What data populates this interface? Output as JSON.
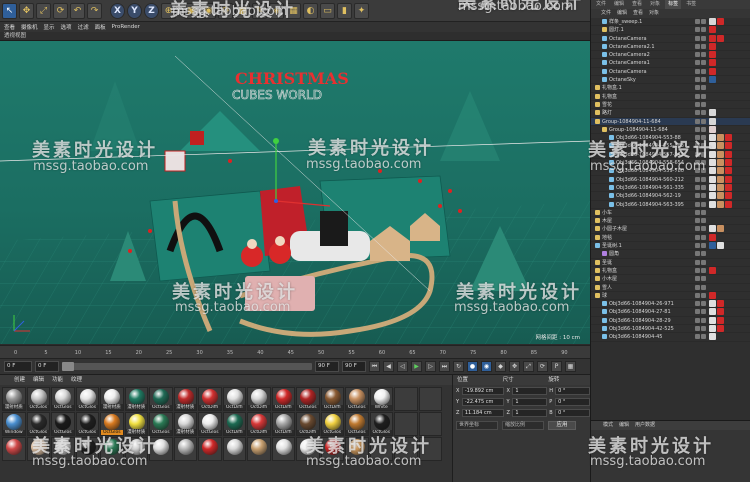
{
  "toolbar": {
    "buttons": [
      "arrow-icon",
      "move-icon",
      "scale-icon",
      "rotate-icon",
      "undo-icon",
      "redo-icon",
      "x-axis",
      "y-axis",
      "z-axis",
      "world-icon",
      "render-view-icon",
      "render-icon",
      "render-settings-icon",
      "cube-icon",
      "pen-icon",
      "subdivision-icon",
      "array-icon",
      "deformer-icon",
      "floor-icon",
      "camera-icon",
      "light-icon"
    ],
    "axis_labels": [
      "X",
      "Y",
      "Z"
    ]
  },
  "viewport": {
    "menu": [
      "查看",
      "摄像机",
      "显示",
      "选项",
      "过滤",
      "面板",
      "ProRender"
    ],
    "header": "透视视图",
    "grid_spacing": "网格间距 : 10 cm",
    "scene_sign_top": "CHRISTMAS",
    "scene_sign_bottom": "CUBES WORLD"
  },
  "timeline": {
    "ticks": [
      "0",
      "5",
      "10",
      "15",
      "20",
      "25",
      "30",
      "35",
      "40",
      "45",
      "50",
      "55",
      "60",
      "65",
      "70",
      "75",
      "80",
      "85",
      "90"
    ],
    "start_frame": "0 F",
    "min_frame": "0 F",
    "max_frame": "90 F",
    "end_frame": "90 F"
  },
  "materials": {
    "menu": [
      "创建",
      "编辑",
      "功能",
      "纹理"
    ],
    "items": [
      {
        "label": "漫射材质",
        "color": "#9a9a9a"
      },
      {
        "label": "OctGlos",
        "color": "#c8c8c8"
      },
      {
        "label": "OctGlos",
        "color": "#d8d8d8"
      },
      {
        "label": "OctGlos",
        "color": "#e6e6e6"
      },
      {
        "label": "漫射材质",
        "color": "#eeeeee"
      },
      {
        "label": "漫射材质",
        "color": "#1f7a62"
      },
      {
        "label": "OctGlos",
        "color": "#1f6a55"
      },
      {
        "label": "漫射材质",
        "color": "#c02a2a"
      },
      {
        "label": "OctDiffi",
        "color": "#d23030"
      },
      {
        "label": "OctDiffi",
        "color": "#e0e0e0"
      },
      {
        "label": "OctDiffi",
        "color": "#d8d8d8"
      },
      {
        "label": "OctDiffi",
        "color": "#d02828"
      },
      {
        "label": "OctGlos",
        "color": "#b02424"
      },
      {
        "label": "OctDiffi",
        "color": "#8a5a32"
      },
      {
        "label": "OctGlos",
        "color": "#c89060"
      },
      {
        "label": "White",
        "color": "#f0f0f0"
      },
      {
        "label": "",
        "color": "#3c3c3c"
      },
      {
        "label": "",
        "color": "#3c3c3c"
      },
      {
        "label": "Window",
        "color": "#4a8fd0"
      },
      {
        "label": "OctGlos",
        "color": "#2a2a2a"
      },
      {
        "label": "OctGlos",
        "color": "#1a1a1a"
      },
      {
        "label": "OctGlos",
        "color": "#1f1f1f"
      },
      {
        "label": "OctGlos",
        "color": "#d87a20"
      },
      {
        "label": "漫射材质",
        "color": "#f0e040"
      },
      {
        "label": "OctGlos",
        "color": "#2a7a55"
      },
      {
        "label": "漫射材质",
        "color": "#d8d8d8"
      },
      {
        "label": "OctGlos",
        "color": "#ececec"
      },
      {
        "label": "OctDiffi",
        "color": "#1c6a52"
      },
      {
        "label": "OctDiffi",
        "color": "#d83838"
      },
      {
        "label": "OctDiffi",
        "color": "#a8a8a8"
      },
      {
        "label": "OctDiffi",
        "color": "#6a4a30"
      },
      {
        "label": "OctGlos",
        "color": "#f0d040"
      },
      {
        "label": "OctGlos",
        "color": "#c07a30"
      },
      {
        "label": "OctGlos",
        "color": "#1e1e1e"
      },
      {
        "label": "",
        "color": "#3c3c3c"
      },
      {
        "label": "",
        "color": "#3c3c3c"
      },
      {
        "label": "",
        "color": "#d04848"
      },
      {
        "label": "",
        "color": "#f0d0b0"
      },
      {
        "label": "",
        "color": "#e0e0e0"
      },
      {
        "label": "",
        "color": "#1e1e1e"
      },
      {
        "label": "",
        "color": "#2a7a55"
      },
      {
        "label": "",
        "color": "#d0d0d0"
      },
      {
        "label": "",
        "color": "#e0e0e0"
      },
      {
        "label": "",
        "color": "#b8b8b8"
      },
      {
        "label": "",
        "color": "#d02828"
      },
      {
        "label": "",
        "color": "#d8d8d8"
      },
      {
        "label": "",
        "color": "#c8a070"
      },
      {
        "label": "",
        "color": "#e0e0e0"
      },
      {
        "label": "",
        "color": "#f0f0f0"
      },
      {
        "label": "",
        "color": "#d02828"
      },
      {
        "label": "",
        "color": "#d8a060"
      },
      {
        "label": "",
        "color": "#3c3c3c"
      },
      {
        "label": "",
        "color": "#3c3c3c"
      },
      {
        "label": "",
        "color": "#3c3c3c"
      }
    ],
    "selected_index": 22
  },
  "attributes": {
    "head": [
      "位置",
      "尺寸",
      "旋转"
    ],
    "rows": [
      {
        "pos_axis": "X",
        "pos": "-19.892 cm",
        "size_axis": "X",
        "size": "1",
        "rot_axis": "H",
        "rot": "0 °"
      },
      {
        "pos_axis": "Y",
        "pos": "-22.475 cm",
        "size_axis": "Y",
        "size": "1",
        "rot_axis": "P",
        "rot": "0 °"
      },
      {
        "pos_axis": "Z",
        "pos": "11.184 cm",
        "size_axis": "Z",
        "size": "1",
        "rot_axis": "B",
        "rot": "0 °"
      }
    ],
    "coord_mode": "世界坐标",
    "size_mode": "缩放比例",
    "apply": "应用"
  },
  "objects": {
    "tabs": [
      "文件",
      "编辑",
      "查看",
      "对象",
      "标签",
      "书签"
    ],
    "active_tab": 4,
    "rows": [
      {
        "label": "样条_sweep.1",
        "indent": 1,
        "icon": "#7ac0e8",
        "tags": [
          "#d8d8d8",
          "#d02828"
        ]
      },
      {
        "label": "圆灯.1",
        "indent": 1,
        "icon": "#e0c060",
        "tags": [
          "#d02828"
        ]
      },
      {
        "label": "OctaneCamera",
        "indent": 1,
        "icon": "#7ac0e8",
        "tags": [
          "#d02828",
          "#d02828"
        ]
      },
      {
        "label": "OctaneCamera2.1",
        "indent": 1,
        "icon": "#7ac0e8",
        "tags": [
          "#d02828"
        ]
      },
      {
        "label": "OctaneCamera2",
        "indent": 1,
        "icon": "#7ac0e8",
        "tags": [
          "#d02828"
        ]
      },
      {
        "label": "OctaneCamera1",
        "indent": 1,
        "icon": "#7ac0e8",
        "tags": [
          "#d02828"
        ]
      },
      {
        "label": "OctaneCamera",
        "indent": 1,
        "icon": "#7ac0e8",
        "tags": [
          "#d02828"
        ]
      },
      {
        "label": "OctaneSky",
        "indent": 1,
        "icon": "#7ac0e8",
        "tags": [
          "#2f5f9a"
        ]
      },
      {
        "label": "礼物盒.1",
        "indent": 0,
        "icon": "#e0c060",
        "tags": []
      },
      {
        "label": "礼物盒",
        "indent": 0,
        "icon": "#e0c060",
        "tags": []
      },
      {
        "label": "雪花",
        "indent": 0,
        "icon": "#e0c060",
        "tags": []
      },
      {
        "label": "路灯",
        "indent": 0,
        "icon": "#e0c060",
        "tags": [
          "#d8d8d8"
        ]
      },
      {
        "label": "Group-1084904-11-684",
        "indent": 0,
        "icon": "#e0c060",
        "tags": [
          "#d8d8d8"
        ]
      },
      {
        "label": "Group-1084904-11-684",
        "indent": 1,
        "icon": "#e0c060",
        "tags": [
          "#e0d0d0"
        ]
      },
      {
        "label": "Obj3d66-1084904-553-88",
        "indent": 2,
        "icon": "#7ac0e8",
        "tags": [
          "#e0e0e0",
          "#c89060",
          "#d02828"
        ]
      },
      {
        "label": "Obj3d66-1084904-555-883",
        "indent": 2,
        "icon": "#7ac0e8",
        "tags": [
          "#e0e0e0",
          "#c89060",
          "#d02828"
        ]
      },
      {
        "label": "Obj3d66-1084904-557-943",
        "indent": 2,
        "icon": "#7ac0e8",
        "tags": [
          "#e0e0e0",
          "#c89060",
          "#d02828"
        ]
      },
      {
        "label": "Obj3d66-1084904-558-654",
        "indent": 2,
        "icon": "#7ac0e8",
        "tags": [
          "#e0e0e0",
          "#c89060",
          "#d02828"
        ]
      },
      {
        "label": "Obj3d66-1084904-559-780",
        "indent": 2,
        "icon": "#7ac0e8",
        "tags": [
          "#e0e0e0",
          "#c89060",
          "#d02828"
        ]
      },
      {
        "label": "Obj3d66-1084904-560-212",
        "indent": 2,
        "icon": "#7ac0e8",
        "tags": [
          "#e0e0e0",
          "#c89060",
          "#d02828"
        ]
      },
      {
        "label": "Obj3d66-1084904-561-335",
        "indent": 2,
        "icon": "#7ac0e8",
        "tags": [
          "#e0e0e0",
          "#c89060",
          "#d02828"
        ]
      },
      {
        "label": "Obj3d66-1084904-562-19",
        "indent": 2,
        "icon": "#7ac0e8",
        "tags": [
          "#e0e0e0",
          "#c89060",
          "#d02828"
        ]
      },
      {
        "label": "Obj3d66-1084904-563-395",
        "indent": 2,
        "icon": "#7ac0e8",
        "tags": [
          "#e0e0e0",
          "#c89060",
          "#d02828"
        ]
      },
      {
        "label": "小车",
        "indent": 0,
        "icon": "#e0c060",
        "tags": []
      },
      {
        "label": "木屋",
        "indent": 0,
        "icon": "#e0c060",
        "tags": []
      },
      {
        "label": "小圆子木屋",
        "indent": 0,
        "icon": "#e0c060",
        "tags": [
          "#e0e0e0",
          "#c89060"
        ]
      },
      {
        "label": "地毯",
        "indent": 0,
        "icon": "#e0c060",
        "tags": [
          "#d02828"
        ]
      },
      {
        "label": "圣诞树.1",
        "indent": 0,
        "icon": "#7ac0e8",
        "tags": [
          "#2f5f9a",
          "#e0e0e0"
        ]
      },
      {
        "label": "圆角",
        "indent": 1,
        "icon": "#b080e0",
        "tags": []
      },
      {
        "label": "圣诞",
        "indent": 0,
        "icon": "#e0c060",
        "tags": []
      },
      {
        "label": "礼物盒",
        "indent": 0,
        "icon": "#e0c060",
        "tags": [
          "#d02828"
        ]
      },
      {
        "label": "小木屋",
        "indent": 0,
        "icon": "#e0c060",
        "tags": []
      },
      {
        "label": "雪人",
        "indent": 0,
        "icon": "#e0c060",
        "tags": []
      },
      {
        "label": "球",
        "indent": 0,
        "icon": "#e0c060",
        "tags": [
          "#d02828"
        ]
      },
      {
        "label": "Obj3d66-1084904-26-971",
        "indent": 1,
        "icon": "#7ac0e8",
        "tags": [
          "#e0e0e0",
          "#d02828"
        ]
      },
      {
        "label": "Obj3d66-1084904-27-81",
        "indent": 1,
        "icon": "#7ac0e8",
        "tags": [
          "#e0e0e0",
          "#d02828"
        ]
      },
      {
        "label": "Obj3d66-1084904-28-29",
        "indent": 1,
        "icon": "#7ac0e8",
        "tags": [
          "#e0e0e0",
          "#d02828"
        ]
      },
      {
        "label": "Obj3d66-1084904-42-525",
        "indent": 1,
        "icon": "#7ac0e8",
        "tags": [
          "#e0e0e0",
          "#d02828"
        ]
      },
      {
        "label": "Obj3d66-1084904-45",
        "indent": 1,
        "icon": "#7ac0e8",
        "tags": [
          "#e0e0e0"
        ]
      }
    ],
    "selected_index": 12
  },
  "properties": {
    "tabs": [
      "模式",
      "编辑",
      "用户数据"
    ],
    "tip": "<>"
  },
  "watermark": {
    "cn": "美素时光设计",
    "url": "mssg.taobao.com"
  }
}
